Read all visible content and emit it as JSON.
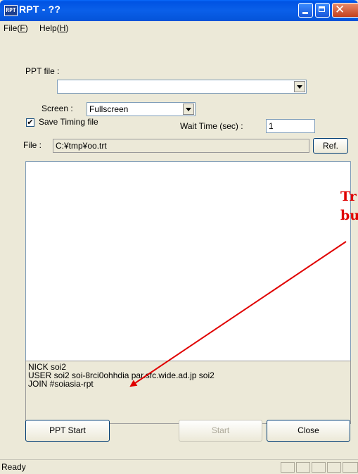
{
  "window": {
    "title": "RPT - ??",
    "icon_label": "RPT"
  },
  "menu": {
    "items": [
      {
        "label": "File(",
        "key": "F",
        "end": ")"
      },
      {
        "label": "Help(",
        "key": "H",
        "end": ")"
      }
    ]
  },
  "form": {
    "ppt_file_label": "PPT file :",
    "ppt_file_value": "",
    "screen_label": "Screen :",
    "screen_value": "Fullscreen",
    "save_timing_label": "Save Timing file",
    "save_timing_checked": "✔",
    "wait_time_label": "Wait Time (sec) :",
    "wait_time_value": "1",
    "file_label": "File :",
    "file_value": "C:¥tmp¥oo.trt",
    "ref_button": "Ref."
  },
  "log": {
    "lines": [
      "NICK soi2",
      "USER soi2 soi-8rci0ohhdia par.sfc.wide.ad.jp soi2",
      "JOIN #soiasia-rpt"
    ]
  },
  "buttons": {
    "ppt_start": "PPT Start",
    "start": "Start",
    "close": "Close"
  },
  "status": {
    "text": "Ready"
  },
  "annotation": {
    "line1": "Tr",
    "line2": "bu"
  }
}
